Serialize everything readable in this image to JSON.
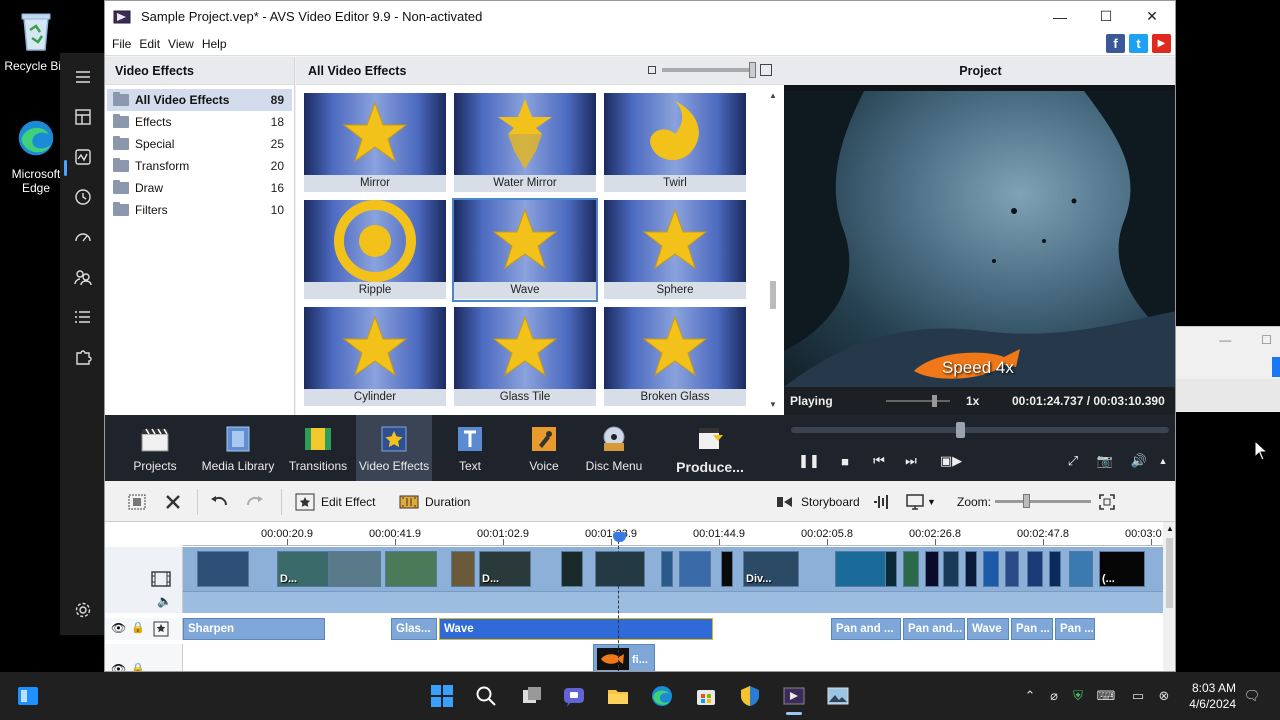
{
  "desktop": {
    "recycle_bin": "Recycle Bin",
    "edge": "Microsoft Edge"
  },
  "window": {
    "title": "Sample Project.vep* - AVS Video Editor 9.9 - Non-activated",
    "minimize": "—",
    "maximize": "☐",
    "close": "✕"
  },
  "menu": [
    "File",
    "Edit",
    "View",
    "Help"
  ],
  "social": [
    "f",
    "t",
    "▶"
  ],
  "categories": {
    "header": "Video Effects",
    "items": [
      {
        "label": "All Video Effects",
        "count": "89"
      },
      {
        "label": "Effects",
        "count": "18"
      },
      {
        "label": "Special",
        "count": "25"
      },
      {
        "label": "Transform",
        "count": "20"
      },
      {
        "label": "Draw",
        "count": "16"
      },
      {
        "label": "Filters",
        "count": "10"
      }
    ]
  },
  "effects": {
    "header": "All Video Effects",
    "tiles": [
      "Mirror",
      "Water Mirror",
      "Twirl",
      "Ripple",
      "Wave",
      "Sphere",
      "Cylinder",
      "Glass Tile",
      "Broken Glass"
    ],
    "selected": "Wave"
  },
  "preview": {
    "header": "Project",
    "overlay": "Speed 4x",
    "state": "Playing",
    "speed": "1x",
    "time": "00:01:24.737 / 00:03:10.390"
  },
  "tools": [
    "Projects",
    "Media Library",
    "Transitions",
    "Video Effects",
    "Text",
    "Voice",
    "Disc Menu",
    "Produce..."
  ],
  "timeline_toolbar": {
    "edit_effect": "Edit Effect",
    "duration": "Duration",
    "storyboard": "Storyboard",
    "zoom": "Zoom:"
  },
  "ruler": [
    "00:00:20.9",
    "00:00:41.9",
    "00:01:02.9",
    "00:01:23.9",
    "00:01:44.9",
    "00:02:05.8",
    "00:02:26.8",
    "00:02:47.8",
    "00:03:0"
  ],
  "video_clip_labels": [
    "D...",
    "D...",
    "Div...",
    "(..."
  ],
  "effect_clips": [
    "Sharpen",
    "Glas...",
    "Wave",
    "Pan and ...",
    "Pan and...",
    "Wave",
    "Pan ...",
    "Pan ..."
  ],
  "text_clip": "fi...",
  "clock": {
    "time": "8:03 AM",
    "date": "4/6/2024"
  },
  "colors": {
    "accent": "#3b7be0",
    "toolbar_bg": "#1f232b",
    "selected_effect": "#2f6ad8",
    "star": "#f2c21b"
  }
}
